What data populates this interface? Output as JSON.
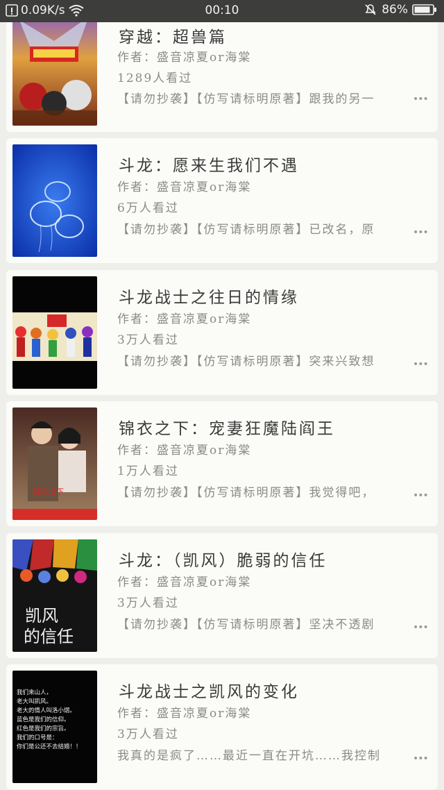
{
  "status_bar": {
    "speed": "0.09K/s",
    "time": "00:10",
    "battery": "86%",
    "icons": [
      "notification-icon",
      "wifi-icon",
      "mute-icon",
      "battery-icon"
    ]
  },
  "books": [
    {
      "title": "穿越：超兽篇",
      "author": "作者：盛音凉夏or海棠",
      "views": "1289人看过",
      "desc": "【请勿抄袭】【仿写请标明原著】跟我的另一",
      "more": "•••"
    },
    {
      "title": "斗龙：愿来生我们不遇",
      "author": "作者：盛音凉夏or海棠",
      "views": "6万人看过",
      "desc": "【请勿抄袭】【仿写请标明原著】已改名，原",
      "more": "•••"
    },
    {
      "title": "斗龙战士之往日的情缘",
      "author": "作者：盛音凉夏or海棠",
      "views": "3万人看过",
      "desc": "【请勿抄袭】【仿写请标明原著】突来兴致想",
      "more": "•••"
    },
    {
      "title": "锦衣之下：宠妻狂魔陆阎王",
      "author": "作者：盛音凉夏or海棠",
      "views": "1万人看过",
      "desc": "【请勿抄袭】【仿写请标明原著】我觉得吧，",
      "more": "•••"
    },
    {
      "title": "斗龙：（凯风）脆弱的信任",
      "author": "作者：盛音凉夏or海棠",
      "views": "3万人看过",
      "desc": "【请勿抄袭】【仿写请标明原著】坚决不透剧",
      "more": "•••"
    },
    {
      "title": "斗龙战士之凯风的变化",
      "author": "作者：盛音凉夏or海棠",
      "views": "3万人看过",
      "desc": "我真的是疯了……最近一直在开坑……我控制",
      "more": "•••"
    }
  ],
  "covers": [
    {
      "text": ""
    },
    {
      "text": ""
    },
    {
      "text": ""
    },
    {
      "text": "锦衣之下"
    },
    {
      "text": "凯风 的信任",
      "line1": "凯风",
      "line2": "的信任"
    },
    {
      "lines": [
        "我们来山人，",
        "老大叫凯风。",
        "老大的情人叫洛小熠。",
        "蓝色是我们的信仰。",
        "红色是我们的宗旨。",
        "我们的口号是：",
        "你们是公还不去结婚！！"
      ]
    }
  ]
}
